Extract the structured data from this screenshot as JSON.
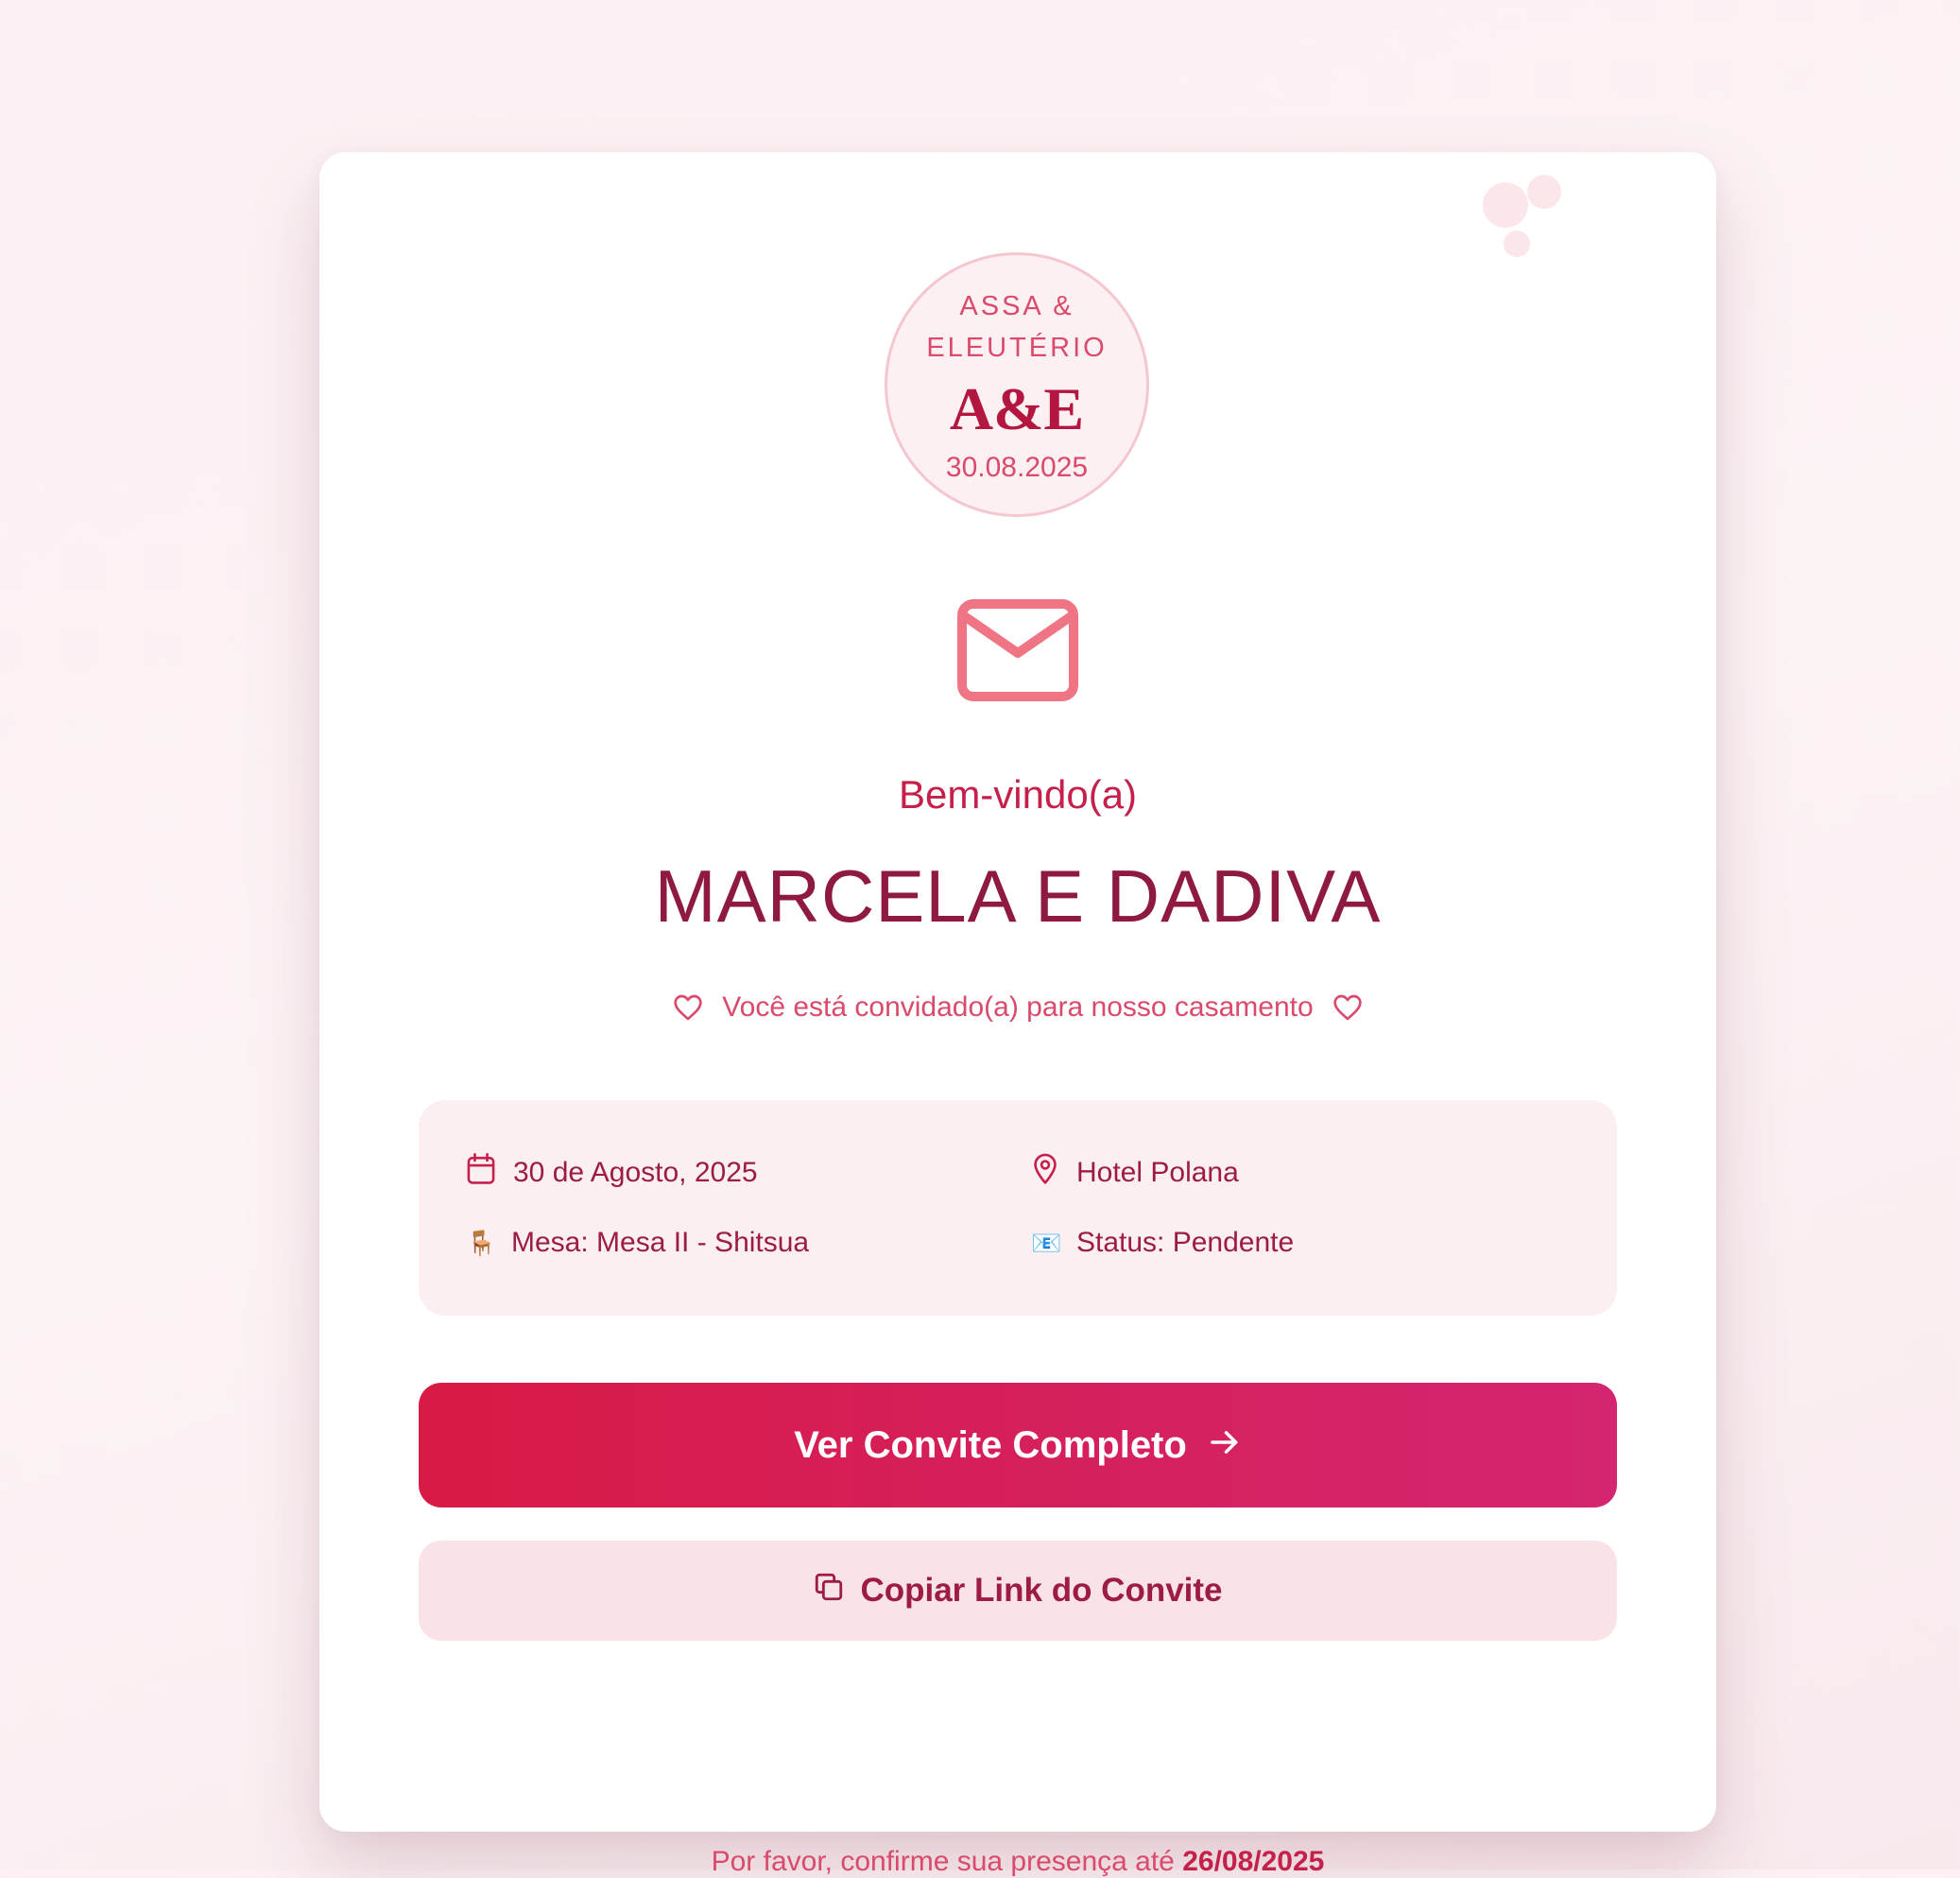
{
  "monogram": {
    "names": "ASSA & ELEUTÉRIO",
    "initials": "A&E",
    "date": "30.08.2025"
  },
  "welcome": "Bem-vindo(a)",
  "guest_name": "MARCELA E DADIVA",
  "invite_line": "Você está convidado(a) para nosso casamento",
  "details": {
    "date": "30 de Agosto, 2025",
    "location": "Hotel Polana",
    "table": "Mesa: Mesa II - Shitsua",
    "status": "Status: Pendente"
  },
  "buttons": {
    "view_invite": "Ver Convite Completo",
    "copy_link": "Copiar Link do Convite"
  },
  "rsvp": {
    "text": "Por favor, confirme sua presença até",
    "deadline": "26/08/2025"
  },
  "icons": {
    "envelope": "envelope-icon",
    "heart": "heart-icon",
    "calendar": "calendar-icon",
    "map_pin": "map-pin-icon",
    "chair": "🪑",
    "mail": "📧",
    "arrow": "arrow-right-icon",
    "copy": "copy-icon"
  },
  "colors": {
    "accent": "#d81a46",
    "accent_end": "#d42570",
    "dark_rose": "#8e1a3f",
    "rose": "#d94a6c",
    "panel": "#fbeff2",
    "secondary_button": "#f9e3e6"
  }
}
